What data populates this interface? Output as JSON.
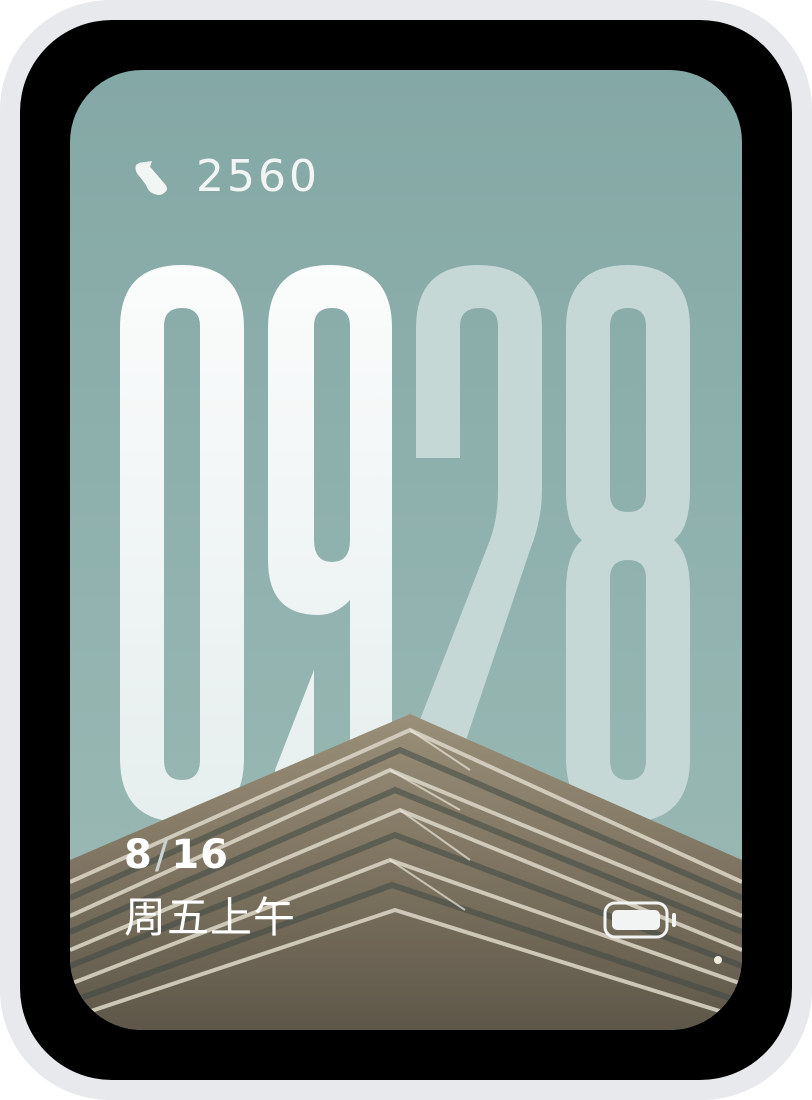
{
  "steps": {
    "icon": "shoe-icon",
    "count": "2560"
  },
  "time": {
    "hour": "09",
    "minute": "28"
  },
  "date": {
    "month": "8",
    "separator": "/",
    "day": "16"
  },
  "weekday_period": "周五上午",
  "battery": {
    "icon": "battery-icon"
  },
  "colors": {
    "sky_top": "#84a8a5",
    "sky_bottom": "#9cbab6",
    "hour_digits": "#f5f8f8",
    "minute_digits": "#c6d8d6",
    "building": "#8f8470"
  }
}
